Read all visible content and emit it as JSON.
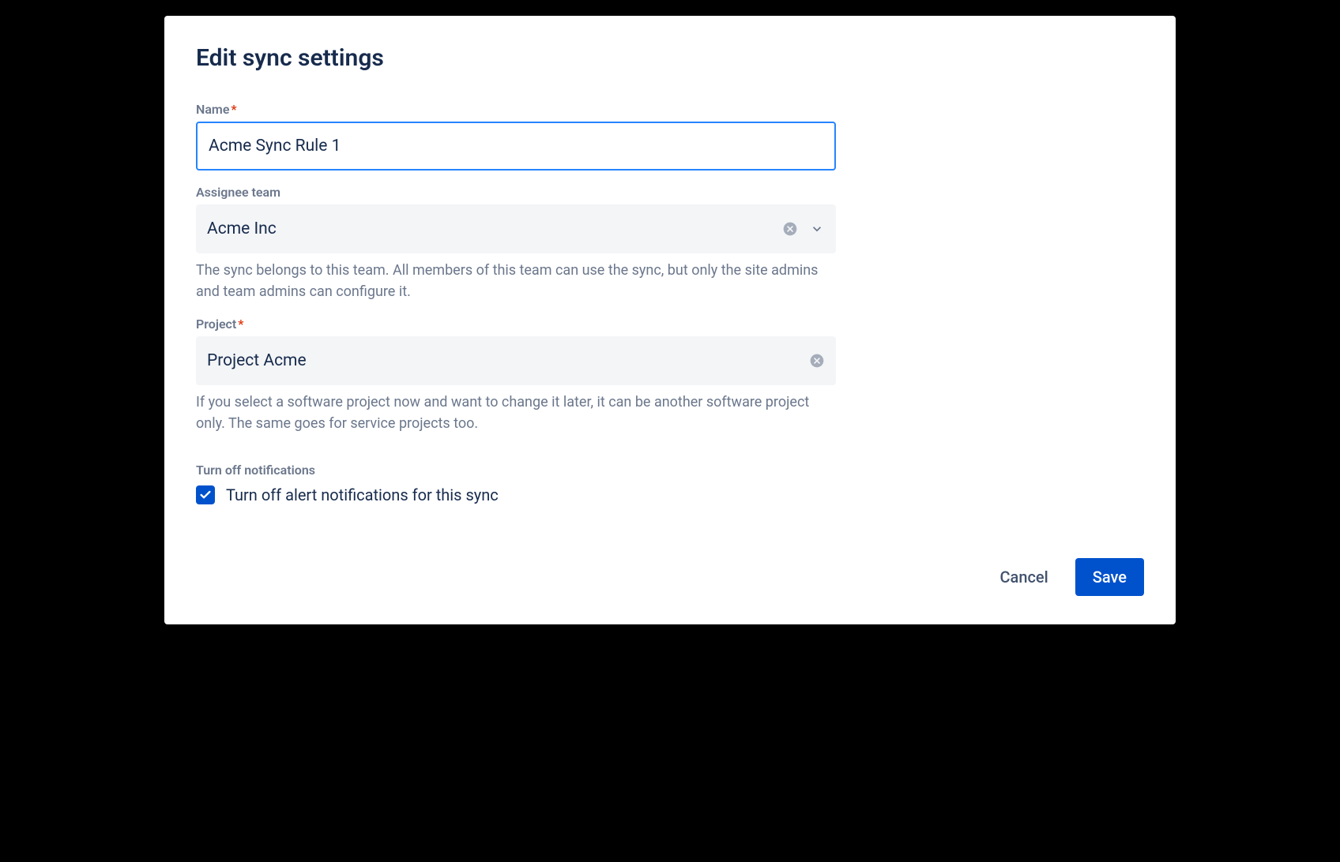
{
  "dialog": {
    "title": "Edit sync settings"
  },
  "fields": {
    "name": {
      "label": "Name",
      "required": true,
      "value": "Acme Sync Rule 1"
    },
    "assignee_team": {
      "label": "Assignee team",
      "value": "Acme Inc",
      "helper": "The sync belongs to this team. All members of this team can use the sync, but only the site admins and team admins can configure it."
    },
    "project": {
      "label": "Project",
      "required": true,
      "value": "Project Acme",
      "helper": "If you select a software project now and want to change it later, it can be another software project only. The same goes for service projects too."
    },
    "notifications": {
      "section_label": "Turn off notifications",
      "checkbox_label": "Turn off alert notifications for this sync",
      "checked": true
    }
  },
  "footer": {
    "cancel": "Cancel",
    "save": "Save"
  }
}
